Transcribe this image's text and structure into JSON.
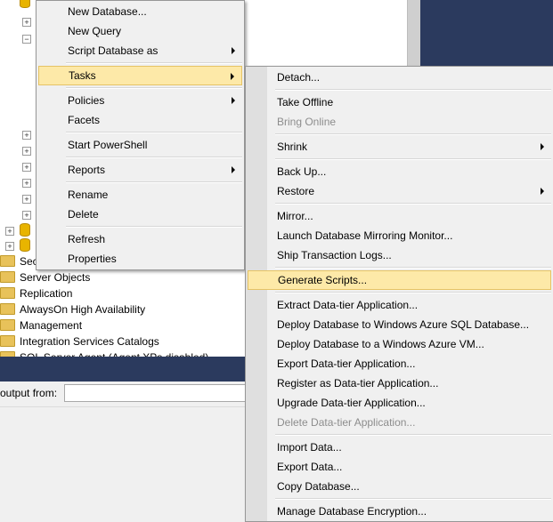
{
  "tree": {
    "nodes": [
      "Security",
      "Server Objects",
      "Replication",
      "AlwaysOn High Availability",
      "Management",
      "Integration Services Catalogs",
      "SQL Server Agent (Agent XPs disabled)"
    ]
  },
  "output": {
    "label": "output from:"
  },
  "main_menu": {
    "items": [
      {
        "label": "New Database...",
        "submenu": false
      },
      {
        "label": "New Query",
        "submenu": false
      },
      {
        "label": "Script Database as",
        "submenu": true
      },
      {
        "label": "Tasks",
        "submenu": true,
        "highlighted": true
      },
      {
        "label": "Policies",
        "submenu": true
      },
      {
        "label": "Facets",
        "submenu": false
      },
      {
        "label": "Start PowerShell",
        "submenu": false
      },
      {
        "label": "Reports",
        "submenu": true
      },
      {
        "label": "Rename",
        "submenu": false
      },
      {
        "label": "Delete",
        "submenu": false
      },
      {
        "label": "Refresh",
        "submenu": false
      },
      {
        "label": "Properties",
        "submenu": false
      }
    ]
  },
  "tasks_menu": {
    "items": [
      {
        "label": "Detach..."
      },
      {
        "label": "Take Offline"
      },
      {
        "label": "Bring Online",
        "disabled": true
      },
      {
        "label": "Shrink",
        "submenu": true
      },
      {
        "label": "Back Up..."
      },
      {
        "label": "Restore",
        "submenu": true
      },
      {
        "label": "Mirror..."
      },
      {
        "label": "Launch Database Mirroring Monitor..."
      },
      {
        "label": "Ship Transaction Logs..."
      },
      {
        "label": "Generate Scripts...",
        "highlighted": true
      },
      {
        "label": "Extract Data-tier Application..."
      },
      {
        "label": "Deploy Database to Windows Azure SQL Database..."
      },
      {
        "label": "Deploy Database to a Windows Azure VM..."
      },
      {
        "label": "Export Data-tier Application..."
      },
      {
        "label": "Register as Data-tier Application..."
      },
      {
        "label": "Upgrade Data-tier Application..."
      },
      {
        "label": "Delete Data-tier Application...",
        "disabled": true
      },
      {
        "label": "Import Data..."
      },
      {
        "label": "Export Data..."
      },
      {
        "label": "Copy Database..."
      },
      {
        "label": "Manage Database Encryption..."
      }
    ]
  }
}
